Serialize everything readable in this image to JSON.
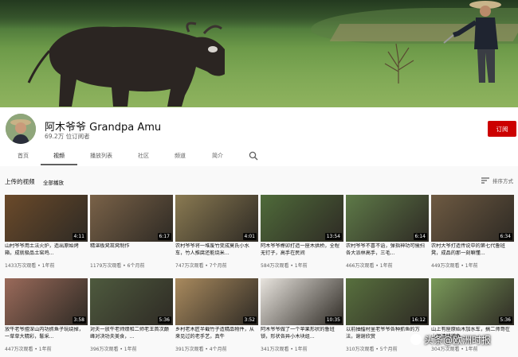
{
  "channel": {
    "name": "阿木爷爷 Grandpa Amu",
    "subscribers": "69.2万 位订阅者",
    "subscribe_label": "订阅"
  },
  "tabs": [
    {
      "label": "首页"
    },
    {
      "label": "视频"
    },
    {
      "label": "播放列表"
    },
    {
      "label": "社区"
    },
    {
      "label": "频道"
    },
    {
      "label": "简介"
    }
  ],
  "icons": {
    "search": "search-icon",
    "sort": "sort-icon"
  },
  "section": {
    "title": "上传的视频",
    "play_all": "全部播放",
    "sort_label": "排序方式"
  },
  "videos": [
    {
      "title": "山村爷爷用土法火炉，造出原始烤箱，成就极品土窑鸡...",
      "meta": "1433万次观看 • 1年前",
      "duration": "4:11",
      "color": "#6b4a2a"
    },
    {
      "title": "精湛板凳茁凳制作",
      "meta": "1179万次观看 • 6个月前",
      "duration": "6:17",
      "color": "#7a6248"
    },
    {
      "title": "农村爷爷将一堆废竹变成莫氏小水车，竹人推腐还能烧米...",
      "meta": "747万次观看 • 7个月前",
      "duration": "4:01",
      "color": "#8a7a52"
    },
    {
      "title": "阿木爷爷榫卯打造一座木拱桥，全程无钉子，高手在民间",
      "meta": "584万次观看 • 1年前",
      "duration": "13:54",
      "color": "#4f6b3a"
    },
    {
      "title": "农村爷爷不喜不语，弹指神功可慑扫各大派林高手，三毛...",
      "meta": "466万次观看 • 1年前",
      "duration": "6:14",
      "color": "#5e7a48"
    },
    {
      "title": "农村大爷打造传说中的第七代鲁班凳，成品的那一刻嘛懂...",
      "meta": "449万次观看 • 1年前",
      "duration": "6:34",
      "color": "#6e5a42"
    },
    {
      "title": "放牛老爷擅深山内功抓鱼子玩绕掉，一草草大精彩，鬈采...",
      "meta": "447万次观看 • 1年前",
      "duration": "3:58",
      "color": "#9a6a5a"
    },
    {
      "title": "对夫一放牛老师煨和二师老王首次巅峰对决功夫美食，...",
      "meta": "396万次观看 • 1年前",
      "duration": "5:36",
      "color": "#4e5a3e"
    },
    {
      "title": "乡村老木匠半截竹子造精品物件，从来见过的老手艺，真牛",
      "meta": "391万次观看 • 4个月前",
      "duration": "3:52",
      "color": "#a98a5e"
    },
    {
      "title": "阿木爷爷做了一个苹果形状的鲁班锁，形状各异小木块组...",
      "meta": "341万次观看 • 1年前",
      "duration": "10:35",
      "color": "#e8e4de"
    },
    {
      "title": "以前抽擂村里老爷爷各种抓鱼的方法，谢谢欣赏",
      "meta": "310万次观看 • 5个月前",
      "duration": "16:12",
      "color": "#58703e"
    },
    {
      "title": "山上有座原始木加水车，搞二师哥在山间清耕捕鱼...",
      "meta": "304万次观看 • 1年前",
      "duration": "5:36",
      "color": "#7a9a5a"
    }
  ],
  "watermark": "头条@欧洲时报"
}
